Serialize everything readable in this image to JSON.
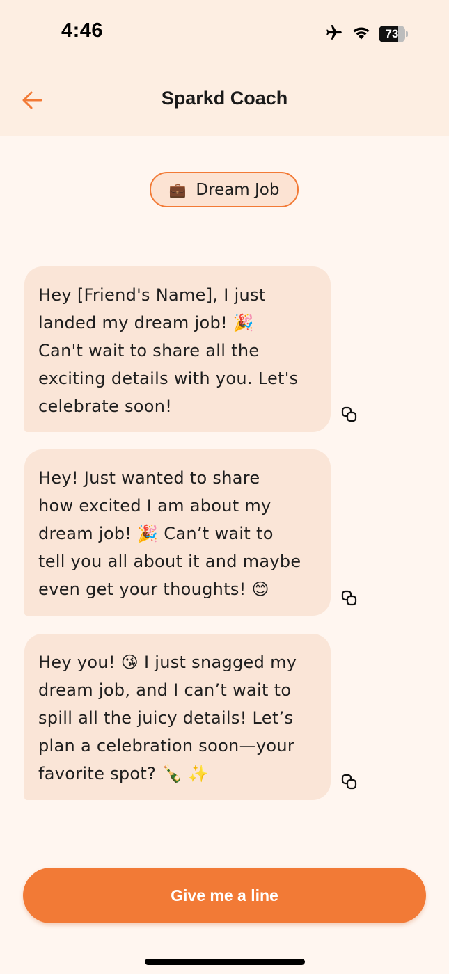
{
  "status_bar": {
    "time": "4:46",
    "battery_level": "73",
    "battery_fraction": 0.73,
    "icons": [
      "airplane-icon",
      "wifi-icon",
      "battery-icon"
    ]
  },
  "header": {
    "title": "Sparkd Coach",
    "back_icon": "arrow-left-icon"
  },
  "topic_chip": {
    "emoji": "💼",
    "label": "Dream Job"
  },
  "messages": [
    {
      "lines": [
        "Hey [Friend's Name], I just",
        "landed my dream job! 🎉",
        "Can't wait to share all the",
        "exciting details with you. Let's",
        "celebrate soon!"
      ]
    },
    {
      "lines": [
        "Hey! Just wanted to share",
        "how excited I am about my",
        "dream job! 🎉  Can’t wait to",
        "tell you all about it and maybe",
        "even get your thoughts! 😊"
      ]
    },
    {
      "lines": [
        "Hey you! 😘  I just snagged my",
        "dream job, and I can’t wait to",
        "spill all the juicy details! Let’s",
        "plan a celebration soon—your",
        "favorite spot? 🍾 ✨"
      ]
    }
  ],
  "cta": {
    "label": "Give me a line"
  },
  "colors": {
    "accent": "#f27a36",
    "header_bg": "#fdeee2",
    "page_bg": "#fff6f0",
    "bubble_bg": "#fae5d7"
  }
}
